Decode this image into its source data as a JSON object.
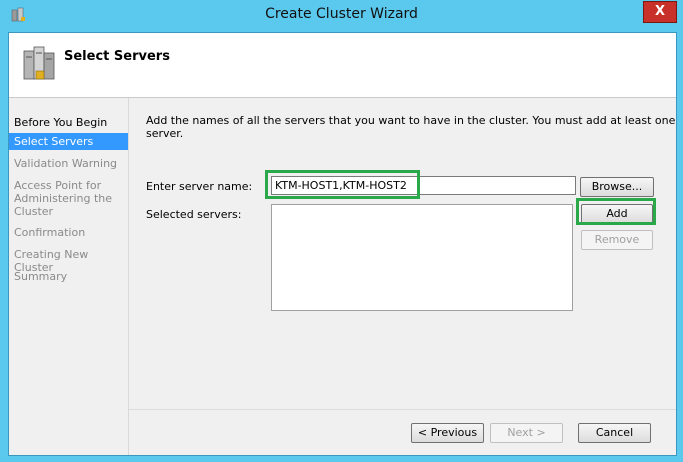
{
  "window": {
    "title": "Create Cluster Wizard",
    "close_glyph": "X"
  },
  "header": {
    "title": "Select Servers"
  },
  "nav": {
    "items": [
      {
        "label": "Before You Begin",
        "state": "done"
      },
      {
        "label": "Select Servers",
        "state": "active"
      },
      {
        "label": "Validation Warning",
        "state": "pending"
      },
      {
        "label": "Access Point for Administering the Cluster",
        "state": "pending"
      },
      {
        "label": "Confirmation",
        "state": "pending"
      },
      {
        "label": "Creating New Cluster",
        "state": "pending"
      },
      {
        "label": "Summary",
        "state": "pending"
      }
    ]
  },
  "content": {
    "description": "Add the names of all the servers that you want to have in the cluster. You must add at least one server.",
    "server_name_label": "Enter server name:",
    "server_name_value": "KTM-HOST1,KTM-HOST2",
    "selected_servers_label": "Selected servers:",
    "browse_label": "Browse...",
    "add_label": "Add",
    "remove_label": "Remove"
  },
  "footer": {
    "previous_label": "< Previous",
    "next_label": "Next >",
    "cancel_label": "Cancel"
  },
  "colors": {
    "highlight": "#2aa84a",
    "accent": "#3399ff",
    "titlebar": "#5bc8ee"
  },
  "icons": {
    "app": "cluster-wizard-icon",
    "header": "servers-icon"
  }
}
